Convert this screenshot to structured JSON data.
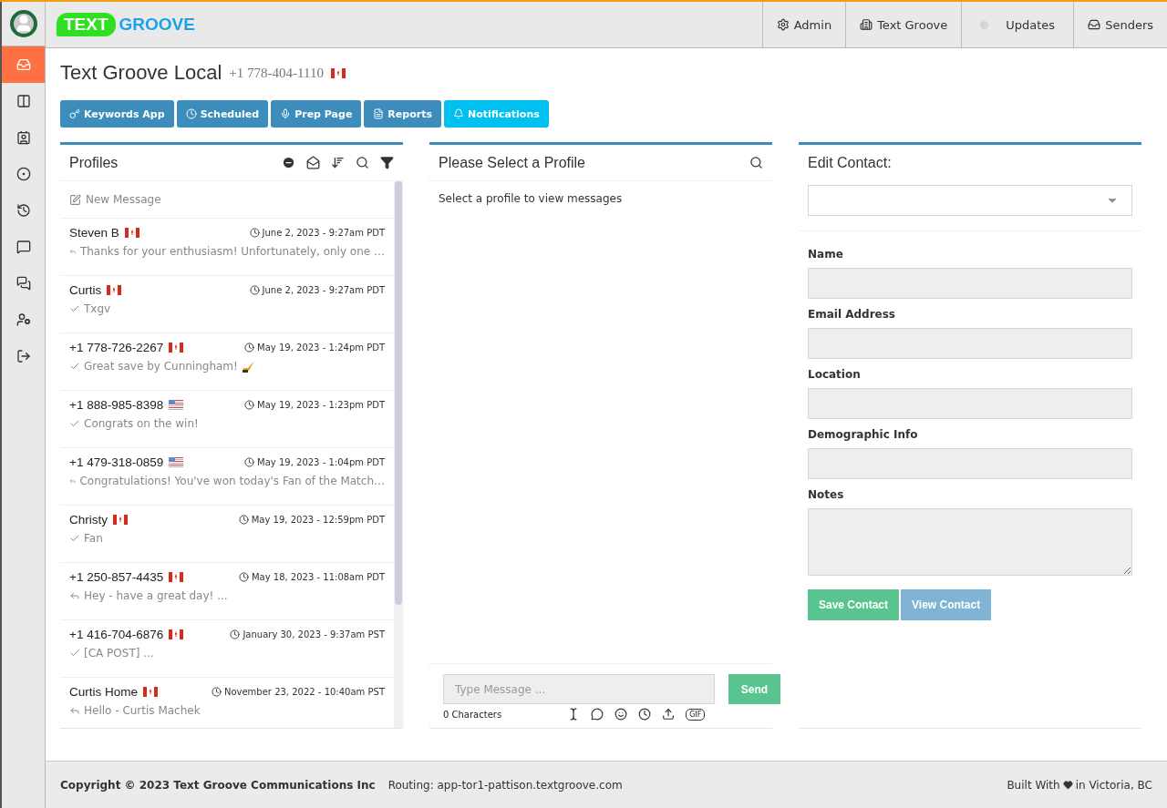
{
  "brand": {
    "word_1": "TEXT",
    "word_2": "GROOVE"
  },
  "nav": [
    {
      "kind": "gear",
      "label": "Admin"
    },
    {
      "kind": "building",
      "label": "Text Groove"
    },
    {
      "kind": "dot",
      "label": "Updates"
    },
    {
      "kind": "inbox",
      "label": "Senders"
    }
  ],
  "sidebar": {
    "items": [
      {
        "kind": "inbox",
        "selected": true
      },
      {
        "kind": "columns",
        "selected": false
      },
      {
        "kind": "contact",
        "selected": false
      },
      {
        "kind": "app",
        "selected": false
      },
      {
        "kind": "reply-clock",
        "selected": false
      },
      {
        "kind": "message",
        "selected": false
      },
      {
        "kind": "chats",
        "selected": false
      },
      {
        "kind": "user-gear",
        "selected": false
      },
      {
        "kind": "logout",
        "selected": false
      }
    ]
  },
  "page": {
    "title": "Text Groove Local",
    "phone": "+1 778-404-1110"
  },
  "actions": [
    {
      "kind": "key",
      "label": "Keywords App"
    },
    {
      "kind": "clock",
      "label": "Scheduled"
    },
    {
      "kind": "mic",
      "label": "Prep Page"
    },
    {
      "kind": "file",
      "label": "Reports"
    },
    {
      "kind": "bell",
      "label": "Notifications"
    }
  ],
  "profiles": {
    "title": "Profiles",
    "new_message": "New Message",
    "items": [
      {
        "name": "Steven B",
        "time": "June 2, 2023 - 9:27am PDT",
        "kind": "replied",
        "preview": "Thanks for your enthusiasm! Unfortunately, only one …"
      },
      {
        "name": "Curtis",
        "time": "June 2, 2023 - 9:27am PDT",
        "kind": "sent",
        "preview": "Txgv"
      },
      {
        "name": "+1 778-726-2267",
        "time": "May 19, 2023 - 1:24pm PDT",
        "kind": "sent",
        "preview": "Great save by Cunningham!"
      },
      {
        "name": "+1 888-985-8398",
        "time": "May 19, 2023 - 1:23pm PDT",
        "kind": "sent",
        "preview": "Congrats on the win!"
      },
      {
        "name": "+1 479-318-0859",
        "time": "May 19, 2023 - 1:04pm PDT",
        "kind": "replied",
        "preview": "Congratulations! You've won today's Fan of the Match…"
      },
      {
        "name": "Christy",
        "time": "May 19, 2023 - 12:59pm PDT",
        "kind": "sent",
        "preview": "Fan"
      },
      {
        "name": "+1 250-857-4435",
        "time": "May 18, 2023 - 11:08am PDT",
        "kind": "replied",
        "preview": "Hey - have a great day! ..."
      },
      {
        "name": "+1 416-704-6876",
        "time": "January 30, 2023 - 9:37am PST",
        "kind": "sent",
        "preview": "[CA POST] ..."
      },
      {
        "name": "Curtis Home",
        "time": "November 23, 2022 - 10:40am PST",
        "kind": "replied",
        "preview": "Hello - Curtis Machek"
      }
    ]
  },
  "messages": {
    "title": "Please Select a Profile",
    "empty_text": "Select a profile to view messages",
    "compose": {
      "placeholder": "Type Message ...",
      "send": "Send",
      "counter": "0 Characters",
      "gif": "GIF"
    }
  },
  "contact": {
    "title": "Edit Contact:",
    "fields": [
      {
        "label": "Name",
        "kind": "text"
      },
      {
        "label": "Email Address",
        "kind": "text"
      },
      {
        "label": "Location",
        "kind": "text"
      },
      {
        "label": "Demographic Info",
        "kind": "text"
      },
      {
        "label": "Notes",
        "kind": "textarea"
      }
    ],
    "buttons": [
      {
        "label": "Save Contact"
      },
      {
        "label": "View Contact"
      }
    ]
  },
  "footer": {
    "copyright": "Copyright © 2023 Text Groove Communications Inc",
    "routing": "Routing: app-tor1-pattison.textgroove.com",
    "built_prefix": "Built With",
    "built_suffix": "in Victoria, BC"
  }
}
